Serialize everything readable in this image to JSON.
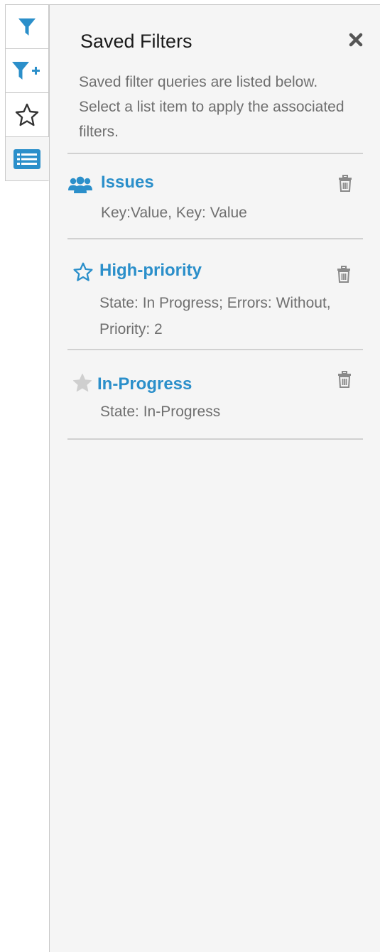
{
  "colors": {
    "accent": "#2b8fca",
    "panel_bg": "#f5f5f5",
    "muted_text": "#6f6f6f",
    "icon_gray": "#8a8a8a",
    "star_inactive": "#cfcfcf"
  },
  "tabs": [
    {
      "icon": "filter-icon",
      "active": false
    },
    {
      "icon": "filter-plus-icon",
      "active": false
    },
    {
      "icon": "star-outline-icon",
      "active": false
    },
    {
      "icon": "list-icon",
      "active": true
    }
  ],
  "drawer": {
    "title": "Saved Filters",
    "close_icon": "close-icon",
    "description": "Saved filter queries are listed below. Select a list item to apply the associated filters."
  },
  "saved_filters": [
    {
      "name": "Issues",
      "query": "Key:Value, Key: Value",
      "icon": "users-icon",
      "delete_icon": "trash-icon"
    },
    {
      "name": "High-priority",
      "query": "State: In Progress; Errors: Without, Priority: 2",
      "icon": "star-outline-icon",
      "delete_icon": "trash-icon"
    },
    {
      "name": "In-Progress",
      "query": "State: In-Progress",
      "icon": "star-filled-icon",
      "delete_icon": "trash-icon"
    }
  ]
}
